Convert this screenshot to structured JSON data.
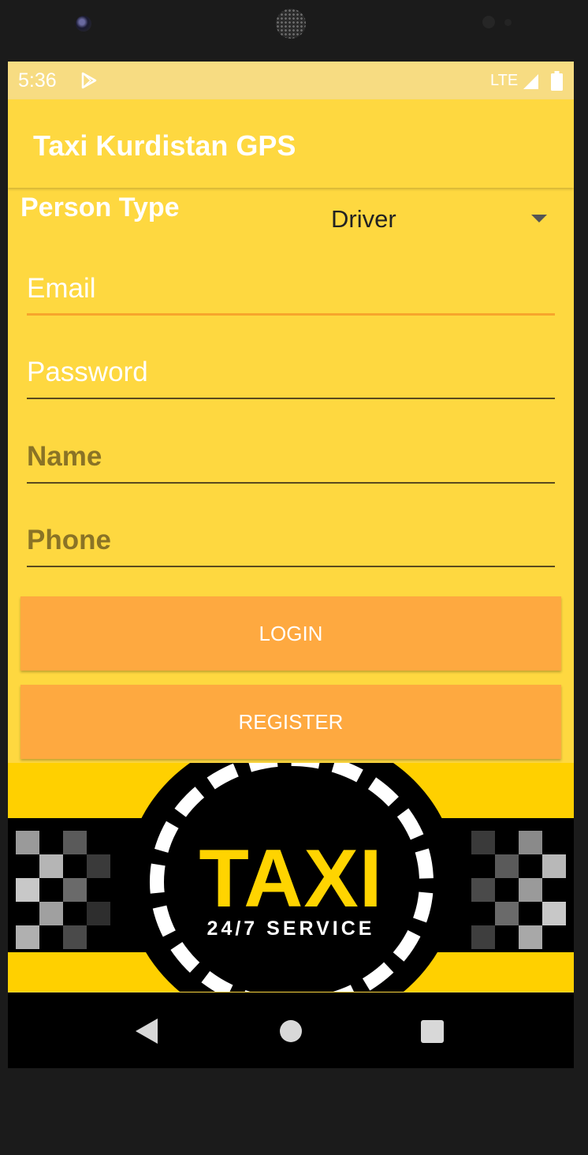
{
  "status_bar": {
    "time": "5:36",
    "network": "LTE"
  },
  "app_bar": {
    "title": "Taxi Kurdistan GPS"
  },
  "person_type": {
    "label": "Person Type",
    "selected": "Driver"
  },
  "form": {
    "email_placeholder": "Email",
    "password_placeholder": "Password",
    "name_placeholder": "Name",
    "phone_placeholder": "Phone"
  },
  "buttons": {
    "login": "LOGIN",
    "register": "REGISTER"
  },
  "banner": {
    "title": "TAXI",
    "subtitle": "24/7 SERVICE"
  },
  "colors": {
    "primary": "#fed840",
    "accent": "#fea940",
    "status_bar": "#f7dc82",
    "focus_line": "#f7a52c"
  },
  "icons": [
    "play-store-icon",
    "signal-icon",
    "battery-icon",
    "dropdown-arrow-icon",
    "back-icon",
    "home-icon",
    "recents-icon"
  ]
}
